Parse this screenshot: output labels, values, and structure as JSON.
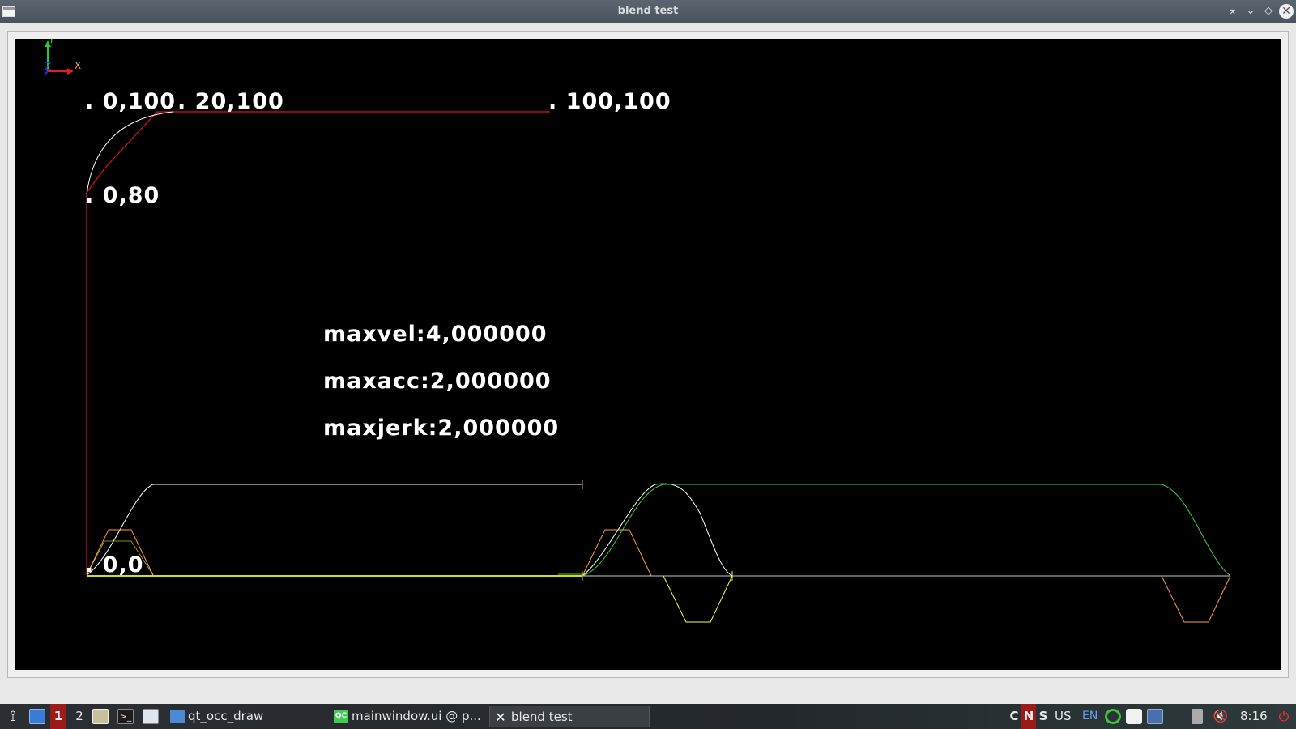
{
  "window": {
    "title": "blend test"
  },
  "titlebar_buttons": [
    {
      "name": "keep-above-icon",
      "glyph": "⌅"
    },
    {
      "name": "minimize-icon",
      "glyph": "⌄"
    },
    {
      "name": "maximize-icon",
      "glyph": "◇"
    },
    {
      "name": "close-icon",
      "glyph": "✕"
    }
  ],
  "viewer": {
    "axes": {
      "x": "X",
      "y": "Y",
      "z": "Z"
    },
    "point_labels": {
      "p0_100": ". 0,100",
      "p20_100": ". 20,100",
      "p100_100": ". 100,100",
      "p0_80": ". 0,80",
      "p0_0": ". 0,0"
    },
    "params": {
      "maxvel": "maxvel:4,000000",
      "maxacc": "maxacc:2,000000",
      "maxjerk": "maxjerk:2,000000"
    },
    "colors": {
      "path": "#e0141e",
      "blend": "#ffffff",
      "velocity": "#ffffff",
      "acceleration": "#ff9a3c",
      "jerk": "#ffff3c",
      "position": "#3cd23c"
    }
  },
  "taskbar": {
    "workspaces": [
      "1",
      "2"
    ],
    "tasks": [
      {
        "label": "qt_occ_draw",
        "icon": "folder-icon"
      },
      {
        "label": "mainwindow.ui @ p...",
        "icon": "qt-creator-icon"
      },
      {
        "label": "blend test",
        "icon": "x-window-icon"
      }
    ],
    "tray": {
      "indicators": [
        "C",
        "N",
        "S"
      ],
      "layout": "US",
      "lang": "EN",
      "clock": "8:16"
    }
  }
}
